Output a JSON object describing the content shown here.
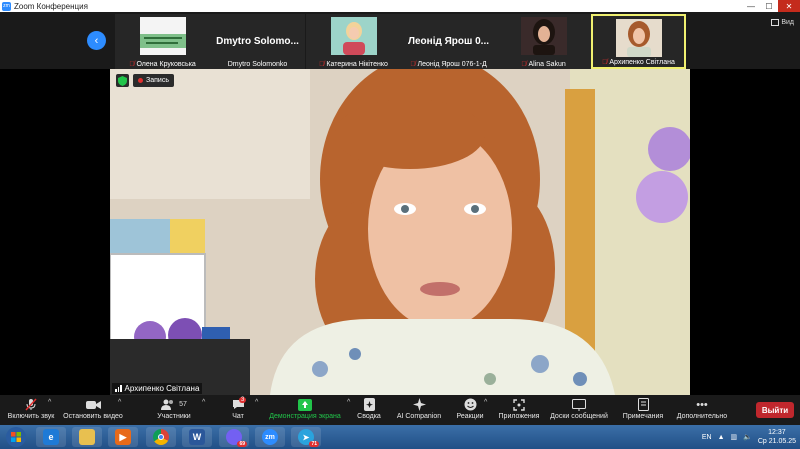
{
  "window": {
    "title": "Zoom Конференция",
    "app_icon": "zm"
  },
  "strip": {
    "view_label": "Вид",
    "tiles": [
      {
        "name": "Олена Круковська",
        "muted": true,
        "type": "slide"
      },
      {
        "name": "Dmytro Solomonko",
        "display": "Dmytro  Solomo...",
        "muted": false,
        "type": "text"
      },
      {
        "name": "Катерина Нікітенко",
        "muted": true,
        "type": "video"
      },
      {
        "name": "Леонід Ярош 076-1-Д",
        "display": "Леонід Ярош 0...",
        "muted": true,
        "type": "text"
      },
      {
        "name": "Alina Sakun",
        "muted": true,
        "type": "video"
      },
      {
        "name": "Архипенко Світлана",
        "muted": true,
        "type": "video",
        "active": true
      }
    ]
  },
  "main": {
    "record_label": "Запись",
    "speaker": "Архипенко Світлана"
  },
  "toolbar": {
    "items": [
      {
        "label": "Включить звук",
        "icon": "mic-off-icon",
        "caret": true
      },
      {
        "label": "Остановить видео",
        "icon": "video-icon",
        "caret": true
      },
      {
        "label": "Участники",
        "icon": "participants-icon",
        "count": "57",
        "caret": true
      },
      {
        "label": "Чат",
        "icon": "chat-icon",
        "badge": "3",
        "caret": true
      },
      {
        "label": "Демонстрация экрана",
        "icon": "share-screen-icon",
        "caret": true
      },
      {
        "label": "Сводка",
        "icon": "summary-icon"
      },
      {
        "label": "AI Companion",
        "icon": "ai-companion-icon"
      },
      {
        "label": "Реакции",
        "icon": "reactions-icon",
        "caret": true
      },
      {
        "label": "Приложения",
        "icon": "apps-icon"
      },
      {
        "label": "Доски сообщений",
        "icon": "whiteboard-icon"
      },
      {
        "label": "Примечания",
        "icon": "notes-icon"
      },
      {
        "label": "Дополнительно",
        "icon": "more-icon"
      }
    ],
    "exit_label": "Выйти"
  },
  "taskbar": {
    "apps": [
      {
        "name": "internet-explorer",
        "glyph": "e"
      },
      {
        "name": "file-explorer",
        "glyph": ""
      },
      {
        "name": "media-player",
        "glyph": "▶"
      },
      {
        "name": "chrome",
        "glyph": ""
      },
      {
        "name": "word",
        "glyph": "W"
      },
      {
        "name": "viber",
        "glyph": "",
        "badge": "69"
      },
      {
        "name": "zoom",
        "glyph": "zm"
      },
      {
        "name": "telegram",
        "glyph": "➤",
        "badge": "71"
      }
    ],
    "lang": "EN",
    "time": "12:37",
    "date": "Ср 21.05.25"
  },
  "colors": {
    "accent": "#2d8cff",
    "share_green": "#21c44a",
    "exit_red": "#c0272d",
    "active_border": "#f0f070"
  }
}
